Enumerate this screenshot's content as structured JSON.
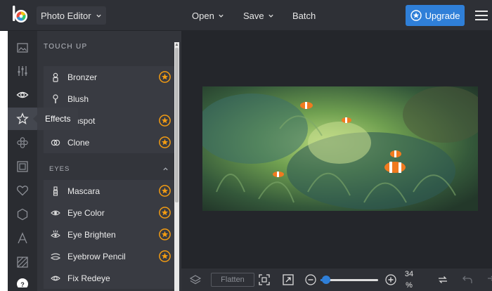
{
  "header": {
    "app_menu_label": "Photo Editor",
    "open_label": "Open",
    "save_label": "Save",
    "batch_label": "Batch",
    "upgrade_label": "Upgrade"
  },
  "rail": {
    "tooltip": "Effects",
    "items": [
      "image-icon",
      "sliders-icon",
      "eye-icon",
      "star-icon",
      "flower-icon",
      "frame-icon",
      "heart-icon",
      "texture-icon",
      "text-icon",
      "hatch-icon",
      "help-icon"
    ]
  },
  "panel": {
    "title": "TOUCH UP",
    "tools_top": [
      {
        "label": "Bronzer",
        "icon": "bronzer-icon",
        "premium": true
      },
      {
        "label": "Blush",
        "icon": "blush-icon",
        "premium": false
      },
      {
        "label": "shspot",
        "icon": "shine-icon",
        "premium": true
      },
      {
        "label": "Clone",
        "icon": "clone-icon",
        "premium": true
      }
    ],
    "section": "EYES",
    "tools_eyes": [
      {
        "label": "Mascara",
        "icon": "mascara-icon",
        "premium": true
      },
      {
        "label": "Eye Color",
        "icon": "eye-color-icon",
        "premium": true
      },
      {
        "label": "Eye Brighten",
        "icon": "eye-brighten-icon",
        "premium": true
      },
      {
        "label": "Eyebrow Pencil",
        "icon": "eyebrow-icon",
        "premium": true
      },
      {
        "label": "Fix Redeye",
        "icon": "redeye-icon",
        "premium": false
      }
    ]
  },
  "bottom": {
    "flatten_label": "Flatten",
    "zoom_value": "34",
    "zoom_unit": "%",
    "zoom_level": 0.1
  },
  "colors": {
    "accent": "#2f7fd8",
    "premium": "#f39c12"
  }
}
